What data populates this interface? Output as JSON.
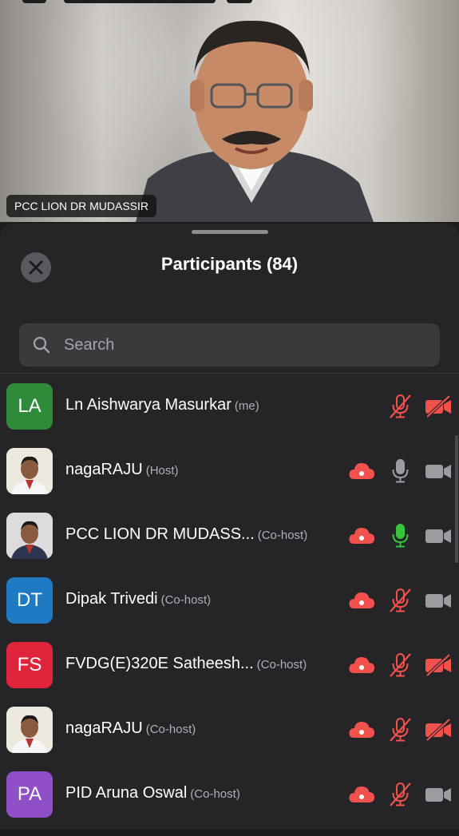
{
  "video": {
    "speaker_label": "PCC LION DR MUDASSIR"
  },
  "panel": {
    "title": "Participants (84)",
    "search_placeholder": "Search"
  },
  "participants": [
    {
      "name": "Ln Aishwarya Masurkar",
      "role": "(me)",
      "initials": "LA",
      "avatar_color": "#2e8b3a",
      "cloud": false,
      "mic": "muted",
      "video": "off"
    },
    {
      "name": "nagaRAJU",
      "role": "(Host)",
      "initials": "",
      "avatar_color": "#f0ece4",
      "cloud": true,
      "mic": "on",
      "video": "on"
    },
    {
      "name": "PCC LION DR MUDASS...",
      "role": "(Co-host)",
      "initials": "",
      "avatar_color": "#e9e9e9",
      "cloud": true,
      "mic": "active",
      "video": "on"
    },
    {
      "name": "Dipak Trivedi",
      "role": "(Co-host)",
      "initials": "DT",
      "avatar_color": "#1f7ac4",
      "cloud": true,
      "mic": "muted",
      "video": "on"
    },
    {
      "name": "FVDG(E)320E Satheesh...",
      "role": "(Co-host)",
      "initials": "FS",
      "avatar_color": "#e0243b",
      "cloud": true,
      "mic": "muted",
      "video": "off"
    },
    {
      "name": "nagaRAJU",
      "role": "(Co-host)",
      "initials": "",
      "avatar_color": "#f0ece4",
      "cloud": true,
      "mic": "muted",
      "video": "off"
    },
    {
      "name": "PID Aruna Oswal",
      "role": "(Co-host)",
      "initials": "PA",
      "avatar_color": "#8e4fc7",
      "cloud": true,
      "mic": "muted",
      "video": "on"
    }
  ],
  "colors": {
    "muted_red": "#f2514e",
    "active_green": "#37c43c",
    "icon_gray": "#9c9ca0"
  }
}
